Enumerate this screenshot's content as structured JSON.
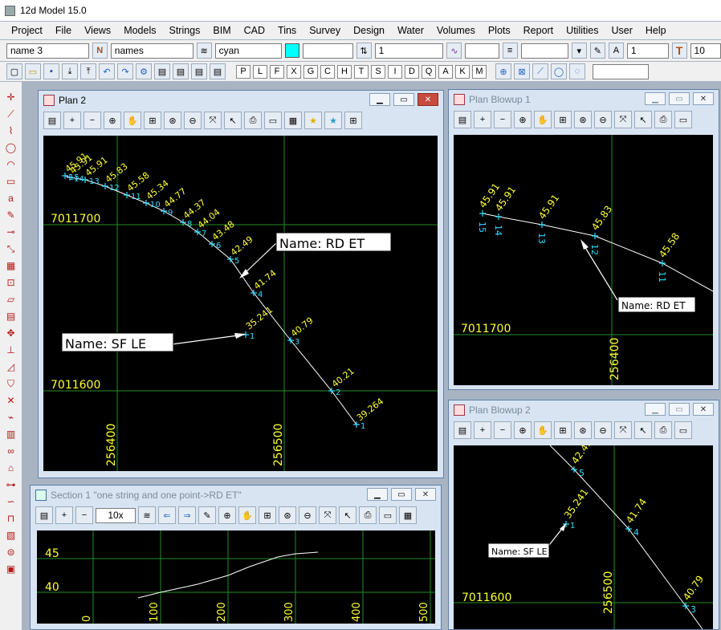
{
  "app": {
    "title": "12d Model  15.0"
  },
  "menu": [
    "Project",
    "File",
    "Views",
    "Models",
    "Strings",
    "BIM",
    "CAD",
    "Tins",
    "Survey",
    "Design",
    "Water",
    "Volumes",
    "Plots",
    "Report",
    "Utilities",
    "User",
    "Help"
  ],
  "toolbar": {
    "name_field": "name 3",
    "n_button": "N",
    "names_field": "names",
    "colour_field": "cyan",
    "colour_swatch": "#00ffff",
    "weight_field": "1",
    "text_size_field": "1",
    "t_button": "T",
    "trailing_field": "10"
  },
  "snaps": [
    "P",
    "L",
    "F",
    "X",
    "G",
    "C",
    "H",
    "T",
    "S",
    "I",
    "D",
    "Q",
    "A",
    "K",
    "M"
  ],
  "plan2": {
    "title": "Plan 2",
    "labels": {
      "rd": "Name: RD ET",
      "sf": "Name: SF LE"
    },
    "grid": {
      "y_hi": "7011700",
      "y_lo": "7011600",
      "x_a": "256400",
      "x_b": "256500"
    },
    "string": [
      {
        "name": "15",
        "val": "45.91"
      },
      {
        "name": "14",
        "val": "45.91"
      },
      {
        "name": "13",
        "val": "45.91"
      },
      {
        "name": "12",
        "val": "45.83"
      },
      {
        "name": "11",
        "val": "45.58"
      },
      {
        "name": "10",
        "val": "45.34"
      },
      {
        "name": "9",
        "val": "44.77"
      },
      {
        "name": "8",
        "val": "44.37"
      },
      {
        "name": "7",
        "val": "44.04"
      },
      {
        "name": "6",
        "val": "43.48"
      },
      {
        "name": "5",
        "val": "42.49"
      },
      {
        "name": "4",
        "val": "41.74"
      },
      {
        "name": "3",
        "val": "40.79"
      },
      {
        "name": "2",
        "val": "40.21"
      },
      {
        "name": "1",
        "val": "39.264"
      }
    ],
    "point": {
      "name": "1",
      "val": "35.241"
    }
  },
  "blowup1": {
    "title": "Plan Blowup 1",
    "label": "Name: RD ET",
    "grid_y": "7011700",
    "grid_x": "256400",
    "points": [
      {
        "name": "15",
        "val": "45.91"
      },
      {
        "name": "14",
        "val": "45.91"
      },
      {
        "name": "13",
        "val": "45.91"
      },
      {
        "name": "12",
        "val": "45.83"
      },
      {
        "name": "11",
        "val": "45.58"
      }
    ]
  },
  "blowup2": {
    "title": "Plan Blowup 2",
    "label": "Name: SF LE",
    "grid_y": "7011600",
    "grid_x": "256500",
    "points": [
      {
        "name": "5",
        "val": "42.49"
      },
      {
        "name": "4",
        "val": "41.74"
      },
      {
        "name": "3",
        "val": "40.79"
      }
    ],
    "point": {
      "name": "1",
      "val": "35.241"
    }
  },
  "section": {
    "title": "Section 1 \"one string and one point->RD ET\"",
    "scale": "10x",
    "y_labels": [
      "45",
      "40"
    ],
    "x_labels": [
      "0",
      "100",
      "200",
      "300",
      "400",
      "500"
    ]
  },
  "colors": {
    "grid": "#1f8f1f",
    "label": "#ffff33",
    "point": "#33ddff",
    "string": "#ffffff"
  }
}
